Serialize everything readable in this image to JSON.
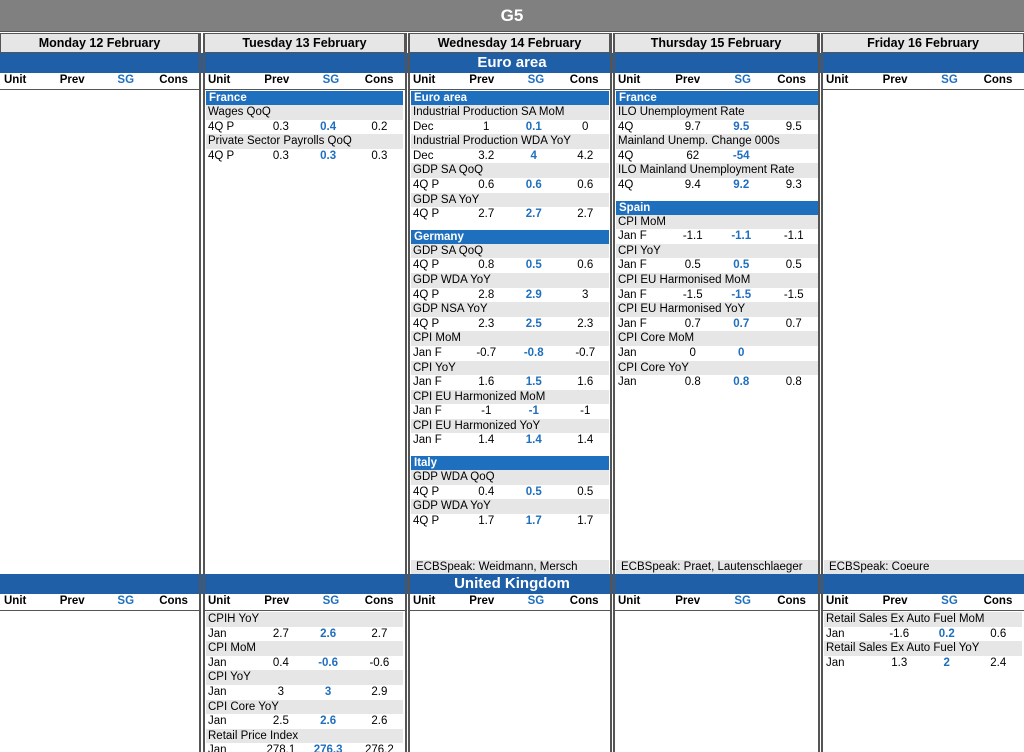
{
  "title": "G5",
  "days": [
    "Monday 12 February",
    "Tuesday 13 February",
    "Wednesday 14 February",
    "Thursday 15 February",
    "Friday 16 February"
  ],
  "col_headers": {
    "unit": "Unit",
    "prev": "Prev",
    "sg": "SG",
    "cons": "Cons"
  },
  "euro_area": {
    "label": "Euro area",
    "tuesday": {
      "country": "France",
      "items": [
        {
          "name": "Wages QoQ",
          "period": "4Q P",
          "prev": "0.3",
          "sg": "0.4",
          "cons": "0.2"
        },
        {
          "name": "Private Sector Payrolls QoQ",
          "period": "4Q P",
          "prev": "0.3",
          "sg": "0.3",
          "cons": "0.3"
        }
      ]
    },
    "wednesday": {
      "groups": [
        {
          "country": "Euro area",
          "items": [
            {
              "name": "Industrial Production SA MoM",
              "period": "Dec",
              "prev": "1",
              "sg": "0.1",
              "cons": "0"
            },
            {
              "name": "Industrial Production WDA YoY",
              "period": "Dec",
              "prev": "3.2",
              "sg": "4",
              "cons": "4.2"
            },
            {
              "name": "GDP SA QoQ",
              "period": "4Q P",
              "prev": "0.6",
              "sg": "0.6",
              "cons": "0.6"
            },
            {
              "name": "GDP SA YoY",
              "period": "4Q P",
              "prev": "2.7",
              "sg": "2.7",
              "cons": "2.7"
            }
          ]
        },
        {
          "country": "Germany",
          "items": [
            {
              "name": "GDP SA QoQ",
              "period": "4Q P",
              "prev": "0.8",
              "sg": "0.5",
              "cons": "0.6"
            },
            {
              "name": "GDP WDA YoY",
              "period": "4Q P",
              "prev": "2.8",
              "sg": "2.9",
              "cons": "3"
            },
            {
              "name": "GDP NSA YoY",
              "period": "4Q P",
              "prev": "2.3",
              "sg": "2.5",
              "cons": "2.3"
            },
            {
              "name": "CPI MoM",
              "period": "Jan F",
              "prev": "-0.7",
              "sg": "-0.8",
              "cons": "-0.7"
            },
            {
              "name": "CPI YoY",
              "period": "Jan F",
              "prev": "1.6",
              "sg": "1.5",
              "cons": "1.6"
            },
            {
              "name": "CPI EU Harmonized MoM",
              "period": "Jan F",
              "prev": "-1",
              "sg": "-1",
              "cons": "-1"
            },
            {
              "name": "CPI EU Harmonized YoY",
              "period": "Jan F",
              "prev": "1.4",
              "sg": "1.4",
              "cons": "1.4"
            }
          ]
        },
        {
          "country": "Italy",
          "items": [
            {
              "name": "GDP WDA QoQ",
              "period": "4Q P",
              "prev": "0.4",
              "sg": "0.5",
              "cons": "0.5"
            },
            {
              "name": "GDP WDA YoY",
              "period": "4Q P",
              "prev": "1.7",
              "sg": "1.7",
              "cons": "1.7"
            }
          ]
        }
      ],
      "speak": "ECBSpeak: Weidmann, Mersch"
    },
    "thursday": {
      "groups": [
        {
          "country": "France",
          "items": [
            {
              "name": "ILO Unemployment Rate",
              "period": "4Q",
              "prev": "9.7",
              "sg": "9.5",
              "cons": "9.5"
            },
            {
              "name": "Mainland Unemp. Change 000s",
              "period": "4Q",
              "prev": "62",
              "sg": "-54",
              "cons": ""
            },
            {
              "name": "ILO Mainland Unemployment Rate",
              "period": "4Q",
              "prev": "9.4",
              "sg": "9.2",
              "cons": "9.3"
            }
          ]
        },
        {
          "country": "Spain",
          "items": [
            {
              "name": "CPI MoM",
              "period": "Jan F",
              "prev": "-1.1",
              "sg": "-1.1",
              "cons": "-1.1"
            },
            {
              "name": "CPI YoY",
              "period": "Jan F",
              "prev": "0.5",
              "sg": "0.5",
              "cons": "0.5"
            },
            {
              "name": "CPI EU Harmonised MoM",
              "period": "Jan F",
              "prev": "-1.5",
              "sg": "-1.5",
              "cons": "-1.5"
            },
            {
              "name": "CPI EU Harmonised YoY",
              "period": "Jan F",
              "prev": "0.7",
              "sg": "0.7",
              "cons": "0.7"
            },
            {
              "name": "CPI Core MoM",
              "period": "Jan",
              "prev": "0",
              "sg": "0",
              "cons": ""
            },
            {
              "name": "CPI Core YoY",
              "period": "Jan",
              "prev": "0.8",
              "sg": "0.8",
              "cons": "0.8"
            }
          ]
        }
      ],
      "speak": "ECBSpeak: Praet, Lautenschlaeger"
    },
    "friday": {
      "speak": "ECBSpeak: Coeure"
    }
  },
  "uk": {
    "label": "United Kingdom",
    "tuesday": {
      "items": [
        {
          "name": "CPIH YoY",
          "period": "Jan",
          "prev": "2.7",
          "sg": "2.6",
          "cons": "2.7"
        },
        {
          "name": "CPI MoM",
          "period": "Jan",
          "prev": "0.4",
          "sg": "-0.6",
          "cons": "-0.6"
        },
        {
          "name": "CPI YoY",
          "period": "Jan",
          "prev": "3",
          "sg": "3",
          "cons": "2.9"
        },
        {
          "name": "CPI Core YoY",
          "period": "Jan",
          "prev": "2.5",
          "sg": "2.6",
          "cons": "2.6"
        },
        {
          "name": "Retail Price Index",
          "period": "Jan",
          "prev": "278.1",
          "sg": "276.3",
          "cons": "276.2"
        }
      ]
    },
    "friday": {
      "items": [
        {
          "name": "Retail Sales Ex Auto Fuel MoM",
          "period": "Jan",
          "prev": "-1.6",
          "sg": "0.2",
          "cons": "0.6"
        },
        {
          "name": "Retail Sales Ex Auto Fuel YoY",
          "period": "Jan",
          "prev": "1.3",
          "sg": "2",
          "cons": "2.4"
        }
      ]
    }
  },
  "colors": {
    "accent": "#1f5fa7",
    "sg_text": "#1f6fbf",
    "title_bg": "#808080",
    "row_bg": "#e6e6e6"
  }
}
